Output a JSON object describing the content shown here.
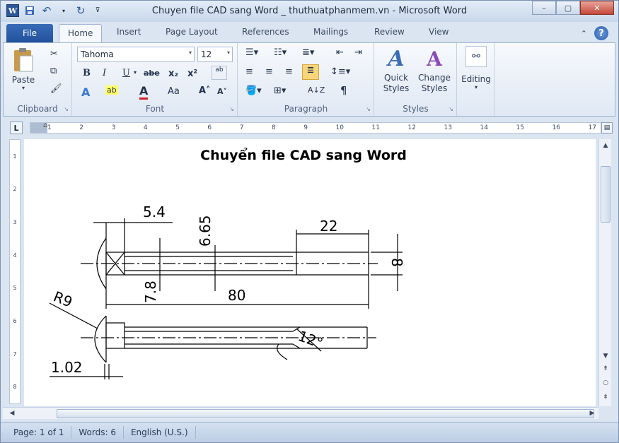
{
  "window": {
    "title": "Chuyen file CAD sang Word _ thuthuatphanmem.vn  -  Microsoft Word",
    "buttons": {
      "minimize": "–",
      "maximize": "▢",
      "close": "✕"
    }
  },
  "quick_access": {
    "app_icon": "W",
    "icons": [
      "save-icon",
      "undo-icon",
      "redo-icon",
      "customize-icon"
    ]
  },
  "tabs": {
    "file": "File",
    "items": [
      "Home",
      "Insert",
      "Page Layout",
      "References",
      "Mailings",
      "Review",
      "View"
    ],
    "active": "Home"
  },
  "ribbon": {
    "clipboard": {
      "label": "Clipboard",
      "paste": "Paste"
    },
    "font": {
      "label": "Font",
      "family": "Tahoma",
      "size": "12"
    },
    "paragraph": {
      "label": "Paragraph"
    },
    "styles": {
      "label": "Styles",
      "quick": "Quick Styles",
      "change": "Change Styles"
    },
    "editing": {
      "label": "Editing"
    }
  },
  "ruler": {
    "numbers": [
      "1",
      "2",
      "3",
      "4",
      "5",
      "6",
      "7",
      "8",
      "9",
      "10",
      "11",
      "12",
      "13",
      "14",
      "15",
      "16",
      "17"
    ]
  },
  "vruler": {
    "numbers": [
      "1",
      "2",
      "3",
      "4",
      "5",
      "6",
      "7",
      "8"
    ]
  },
  "document": {
    "title": "Chuyển file CAD sang Word",
    "drawing_labels": {
      "d54": "5.4",
      "d665": "6.65",
      "d22": "22",
      "d8": "8",
      "d78": "7.8",
      "d80": "80",
      "r9": "R9",
      "a12": "12°",
      "d102": "1.02"
    }
  },
  "status": {
    "page": "Page: 1 of 1",
    "words": "Words: 6",
    "language": "English (U.S.)"
  },
  "colors": {
    "accent": "#2b5797",
    "ribbon_bg": "#dfe8f4"
  }
}
